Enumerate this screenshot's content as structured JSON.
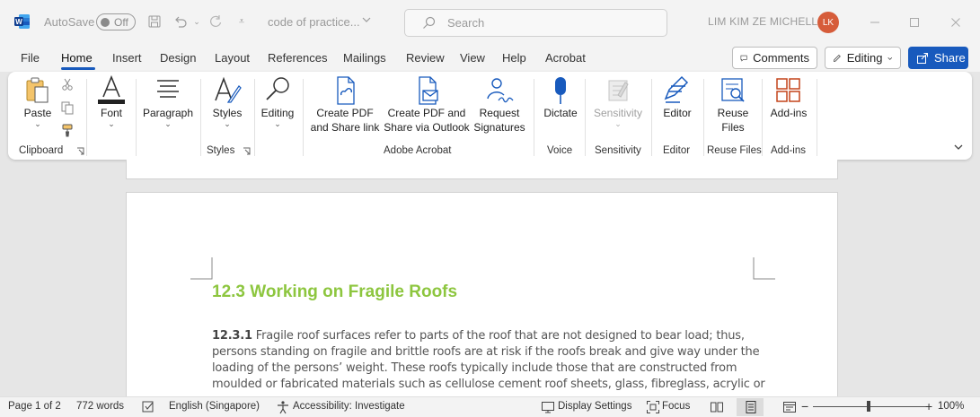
{
  "titlebar": {
    "autosave_label": "AutoSave",
    "autosave_state": "Off",
    "doc_title": "code of practice...",
    "search_placeholder": "Search",
    "user_name": "LIM KIM ZE MICHELL",
    "avatar_initials": "LK",
    "avatar_color": "#d65c3a"
  },
  "tabs": [
    "File",
    "Home",
    "Insert",
    "Design",
    "Layout",
    "References",
    "Mailings",
    "Review",
    "View",
    "Help",
    "Acrobat"
  ],
  "active_tab": "Home",
  "actions": {
    "comments": "Comments",
    "editing": "Editing",
    "share": "Share",
    "share_color": "#185abd"
  },
  "ribbon": {
    "clipboard": {
      "paste": "Paste",
      "group": "Clipboard"
    },
    "font": {
      "label": "Font"
    },
    "paragraph": {
      "label": "Paragraph"
    },
    "styles": {
      "label": "Styles",
      "group": "Styles"
    },
    "editing": {
      "label": "Editing"
    },
    "acrobat": {
      "create_pdf_1": "Create PDF",
      "create_pdf_2": "and Share link",
      "outlook_1": "Create PDF and",
      "outlook_2": "Share via Outlook",
      "request_1": "Request",
      "request_2": "Signatures",
      "group": "Adobe Acrobat"
    },
    "voice": {
      "dictate": "Dictate",
      "group": "Voice"
    },
    "sensitivity": {
      "label": "Sensitivity",
      "group": "Sensitivity"
    },
    "editor": {
      "label": "Editor",
      "group": "Editor"
    },
    "reuse": {
      "label_1": "Reuse",
      "label_2": "Files",
      "group": "Reuse Files"
    },
    "addins": {
      "label": "Add-ins",
      "group": "Add-ins"
    }
  },
  "document": {
    "heading": "12.3 Working on Fragile Roofs",
    "heading_color": "#8dc63f",
    "para_number": "12.3.1",
    "para_lines": [
      " Fragile roof surfaces refer to parts of the roof that are not designed to bear load; thus,",
      "persons standing on fragile and brittle roofs are at risk if the roofs break and give way under the",
      "loading of the persons’ weight. These roofs typically include those that are constructed from",
      "moulded or fabricated materials such as cellulose cement roof sheets, glass, fibreglass, acrylic or"
    ]
  },
  "status": {
    "page": "Page 1 of 2",
    "words": "772 words",
    "language": "English (Singapore)",
    "accessibility": "Accessibility: Investigate",
    "display_settings": "Display Settings",
    "focus": "Focus",
    "zoom": "100%"
  }
}
